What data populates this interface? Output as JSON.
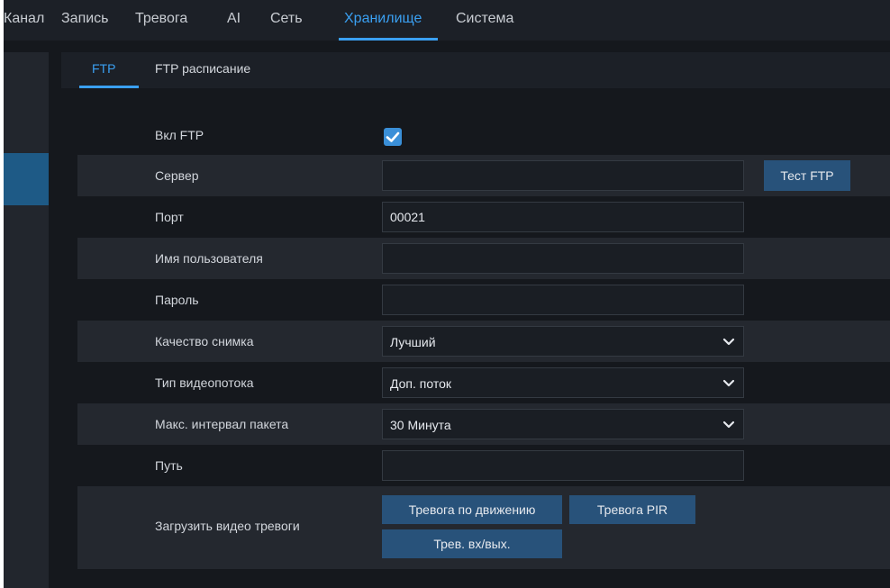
{
  "top_nav": {
    "items": [
      {
        "label": "Канал"
      },
      {
        "label": "Запись"
      },
      {
        "label": "Тревога"
      },
      {
        "label": "AI"
      },
      {
        "label": "Сеть"
      },
      {
        "label": "Хранилище",
        "active": true
      },
      {
        "label": "Система"
      }
    ]
  },
  "sub_tabs": {
    "items": [
      {
        "label": "FTP",
        "active": true
      },
      {
        "label": "FTP расписание"
      }
    ]
  },
  "form": {
    "enable_ftp": {
      "label": "Вкл FTP",
      "checked": true
    },
    "server": {
      "label": "Сервер",
      "value": "",
      "test_button": "Тест FTP"
    },
    "port": {
      "label": "Порт",
      "value": "00021"
    },
    "username": {
      "label": "Имя пользователя",
      "value": ""
    },
    "password": {
      "label": "Пароль",
      "value": ""
    },
    "snapshot_quality": {
      "label": "Качество снимка",
      "value": "Лучший"
    },
    "stream_type": {
      "label": "Тип видеопотока",
      "value": "Доп. поток"
    },
    "max_packet_interval": {
      "label": "Макс. интервал пакета",
      "value": "30 Минута"
    },
    "path": {
      "label": "Путь",
      "value": ""
    },
    "upload_alarm_video": {
      "label": "Загрузить видео тревоги",
      "buttons": {
        "motion": "Тревога по движению",
        "pir": "Тревога PIR",
        "io": "Трев. вх/вых."
      }
    }
  },
  "colors": {
    "accent": "#3aa0f2",
    "background": "#15181d",
    "row_shade": "#24282f",
    "button": "#28527a"
  }
}
